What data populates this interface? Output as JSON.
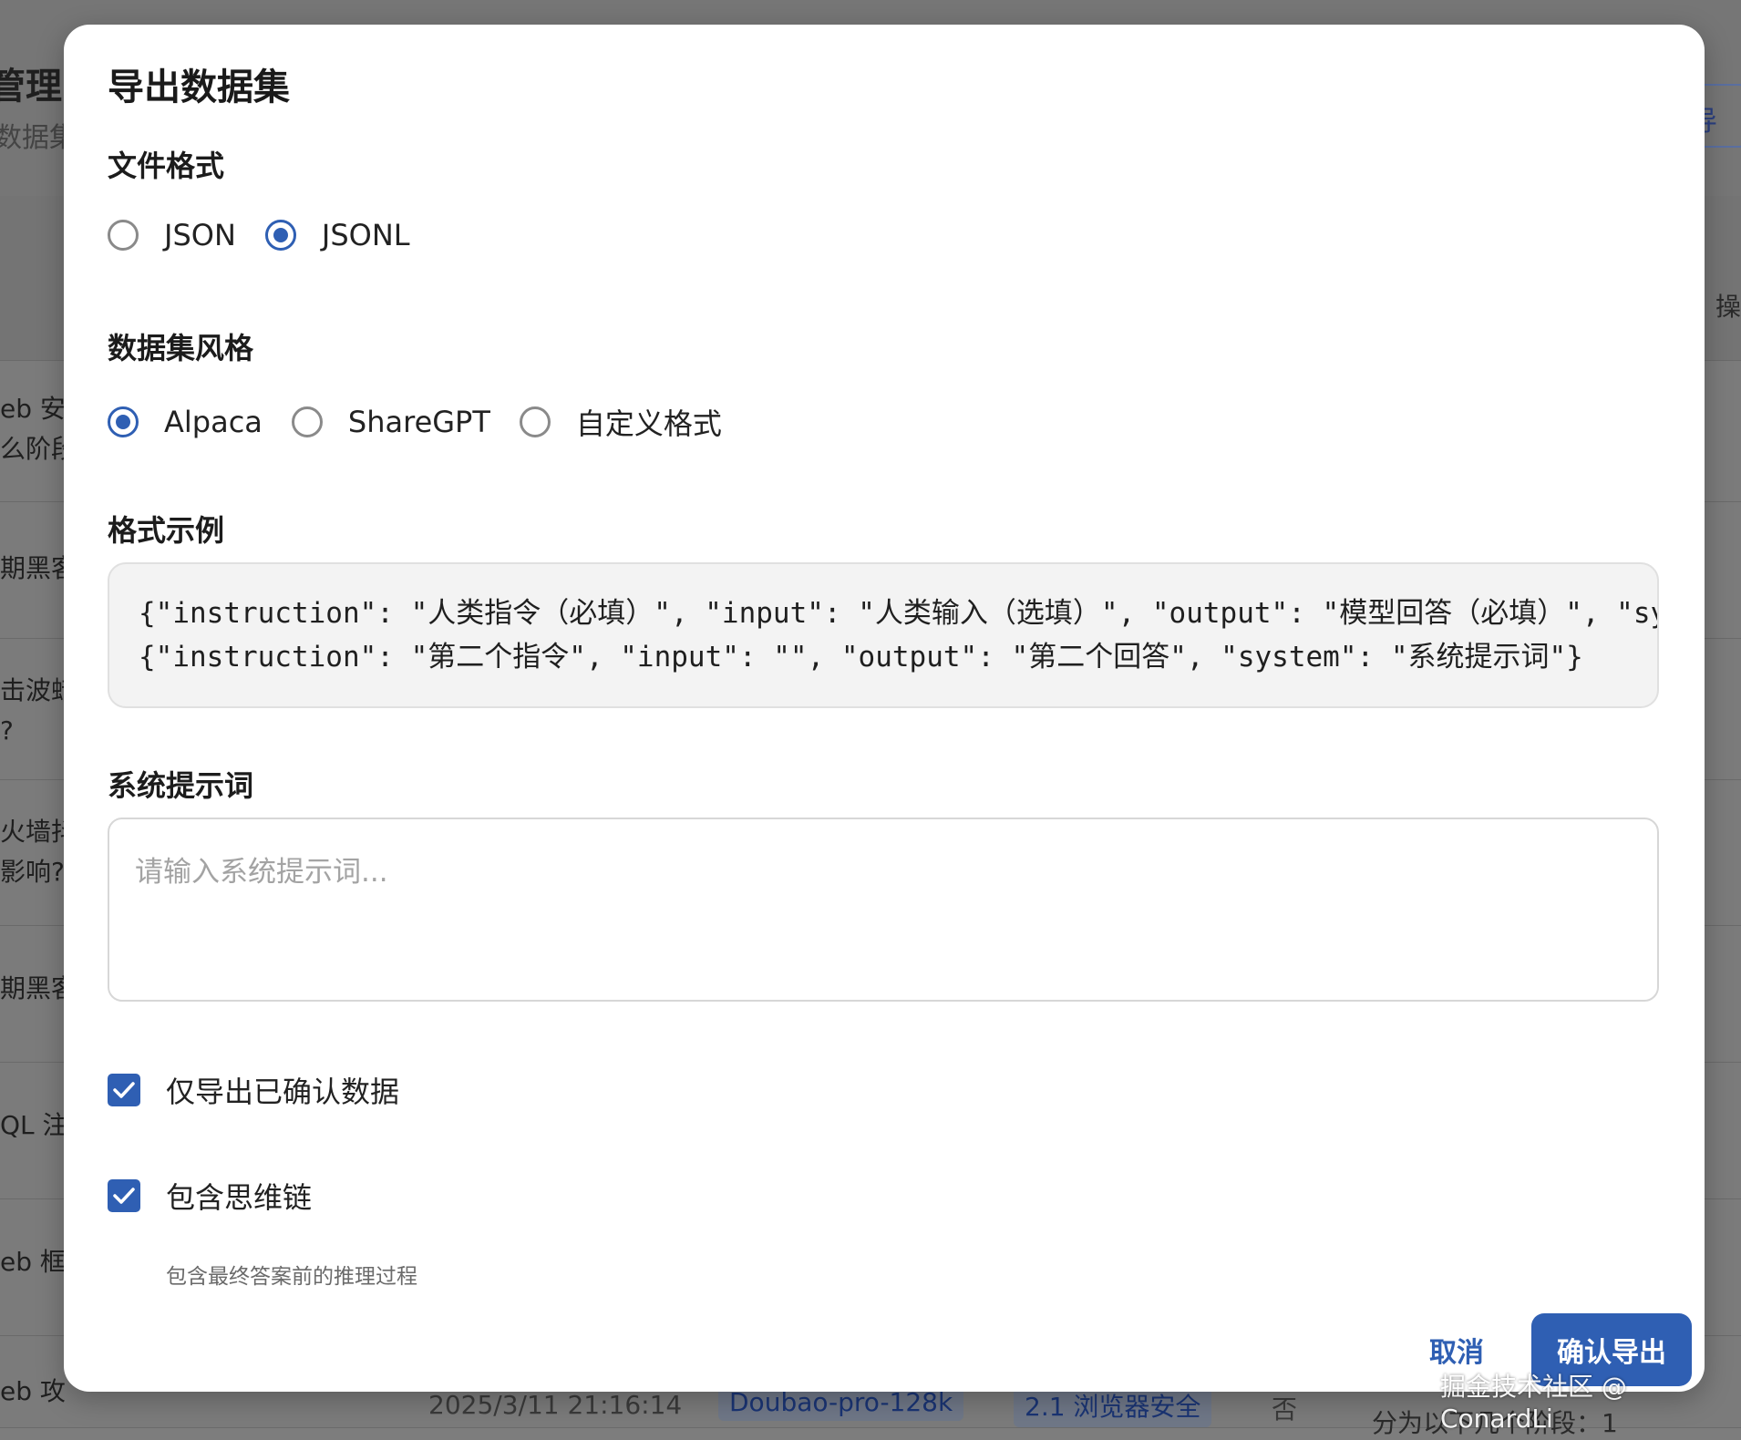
{
  "background": {
    "page_title": "管理",
    "page_subtitle": "数据集",
    "right_button_label": "导",
    "col_header": "操",
    "rows": [
      "eb 安\n么阶段",
      "期黑客",
      "击波蜡\n?",
      "火墙抖\n影响?",
      "期黑客",
      "QL 注入",
      "eb 框",
      "eb 攻"
    ],
    "footer": {
      "date": "2025/3/11 21:16:14",
      "model": "Doubao-pro-128k",
      "tag": "2.1 浏览器安全",
      "confirmed": "否",
      "desc": "分为以下几个阶段：1"
    }
  },
  "modal": {
    "title": "导出数据集",
    "file_format": {
      "label": "文件格式",
      "options": [
        "JSON",
        "JSONL"
      ],
      "selected": "JSONL"
    },
    "dataset_style": {
      "label": "数据集风格",
      "options": [
        "Alpaca",
        "ShareGPT",
        "自定义格式"
      ],
      "selected": "Alpaca"
    },
    "format_example": {
      "label": "格式示例",
      "lines": [
        "{\"instruction\": \"人类指令（必填）\", \"input\": \"人类输入（选填）\", \"output\": \"模型回答（必填）\", \"system\": \"系统提示词\"}",
        "{\"instruction\": \"第二个指令\", \"input\": \"\", \"output\": \"第二个回答\", \"system\": \"系统提示词\"}"
      ]
    },
    "system_prompt": {
      "label": "系统提示词",
      "placeholder": "请输入系统提示词...",
      "value": ""
    },
    "only_confirmed": {
      "label": "仅导出已确认数据",
      "checked": true
    },
    "include_cot": {
      "label": "包含思维链",
      "checked": true,
      "helper": "包含最终答案前的推理过程"
    },
    "cancel_label": "取消",
    "confirm_label": "确认导出"
  },
  "watermark": "掘金技术社区 @ ConardLi",
  "colors": {
    "accent": "#2f5fb3",
    "overlay": "#7b7b7b"
  }
}
